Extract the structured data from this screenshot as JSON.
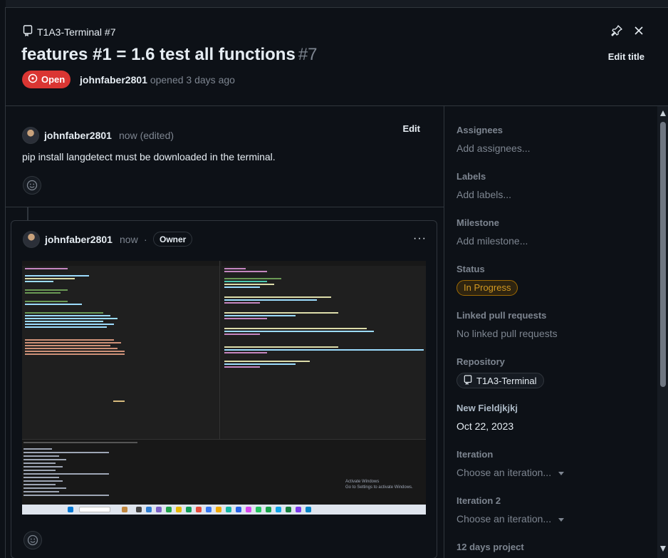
{
  "header": {
    "repo_ref": "T1A3-Terminal #7",
    "title": "features #1 = 1.6 test all functions",
    "number": "#7",
    "edit_title_label": "Edit title",
    "state_label": "Open",
    "author": "johnfaber2801",
    "opened_text": "opened 3 days ago"
  },
  "comments": [
    {
      "author": "johnfaber2801",
      "time": "now (edited)",
      "edit_label": "Edit",
      "body": "pip install langdetect must be downloaded in the terminal."
    },
    {
      "author": "johnfaber2801",
      "time": "now",
      "separator": "·",
      "badge": "Owner",
      "more": "···",
      "screenshot": {
        "watermark_line1": "Activate Windows",
        "watermark_line2": "Go to Settings to activate Windows."
      }
    }
  ],
  "sidebar": {
    "assignees": {
      "label": "Assignees",
      "value": "Add assignees..."
    },
    "labels": {
      "label": "Labels",
      "value": "Add labels..."
    },
    "milestone": {
      "label": "Milestone",
      "value": "Add milestone..."
    },
    "status": {
      "label": "Status",
      "value": "In Progress"
    },
    "linked_prs": {
      "label": "Linked pull requests",
      "value": "No linked pull requests"
    },
    "repository": {
      "label": "Repository",
      "value": "T1A3-Terminal"
    },
    "new_field": {
      "label": "New Fieldjkjkj",
      "value": "Oct 22, 2023"
    },
    "iteration": {
      "label": "Iteration",
      "value": "Choose an iteration..."
    },
    "iteration2": {
      "label": "Iteration 2",
      "value": "Choose an iteration..."
    },
    "days_project": {
      "label": "12 days project"
    }
  },
  "colors": {
    "background": "#0d1117",
    "open_badge": "#da3633",
    "status_badge": "#d29922",
    "border": "#30363d"
  },
  "icons": {
    "repo": "repo-icon",
    "pin": "pin-icon",
    "close": "close-icon",
    "issue_open": "issue-opened-icon",
    "smiley": "smiley-icon",
    "kebab": "kebab-horizontal-icon"
  }
}
